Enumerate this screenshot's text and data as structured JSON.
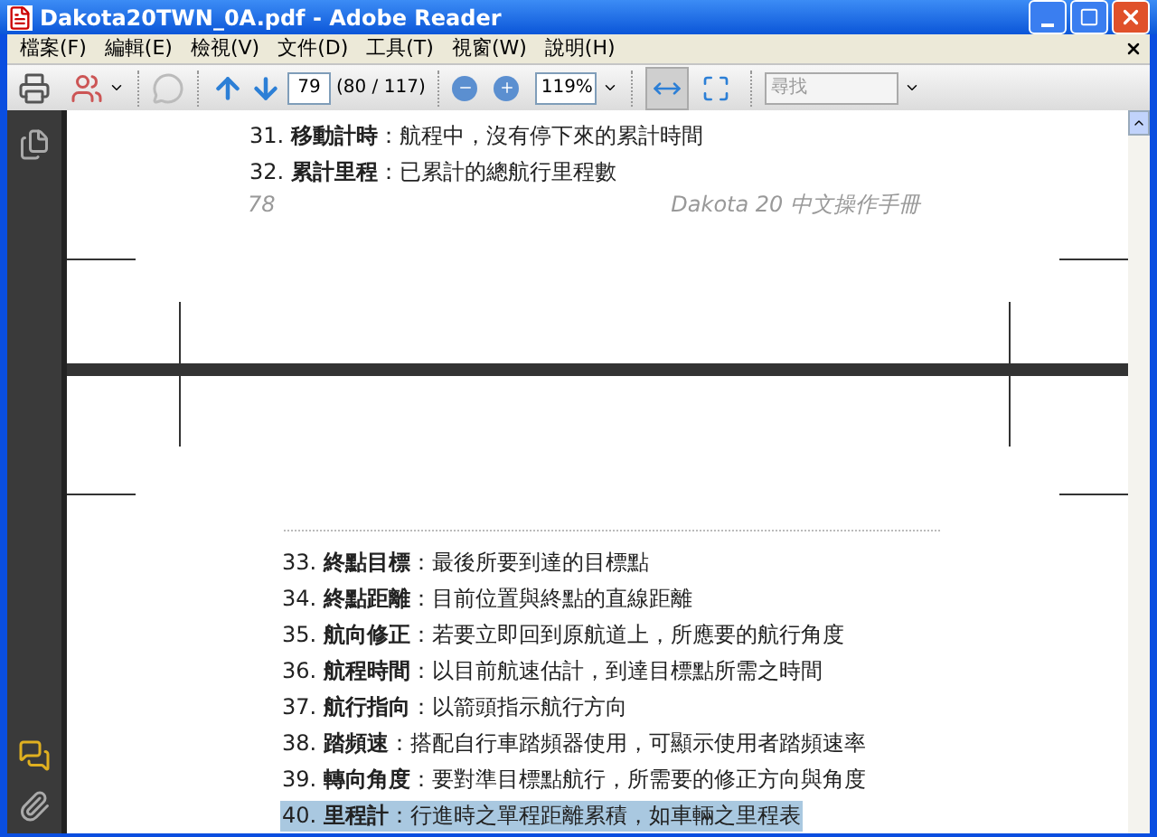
{
  "window": {
    "title": "Dakota20TWN_0A.pdf - Adobe Reader"
  },
  "menu": [
    "檔案(F)",
    "編輯(E)",
    "檢視(V)",
    "文件(D)",
    "工具(T)",
    "視窗(W)",
    "說明(H)"
  ],
  "toolbar": {
    "page_number": "79",
    "page_count": "(80 / 117)",
    "zoom": "119%",
    "search": {
      "placeholder": "尋找"
    },
    "fit_width_pressed": true
  },
  "page_top": {
    "items": [
      {
        "text": "31. **移動計時**：航程中，沒有停下來的累計時間",
        "selected": false
      },
      {
        "text": "32. **累計里程**：已累計的總航行里程數",
        "selected": false
      }
    ],
    "page_number": "78",
    "footer_title": "Dakota 20 中文操作手冊"
  },
  "page_bottom": {
    "items": [
      {
        "text": "33. **終點目標**：最後所要到達的目標點",
        "selected": false
      },
      {
        "text": "34. **終點距離**：目前位置與終點的直線距離",
        "selected": false
      },
      {
        "text": "35. **航向修正**：若要立即回到原航道上，所應要的航行角度",
        "selected": false
      },
      {
        "text": "36. **航程時間**：以目前航速估計，到達目標點所需之時間",
        "selected": false
      },
      {
        "text": "37. **航行指向**：以箭頭指示航行方向",
        "selected": false
      },
      {
        "text": "38. **踏頻速**：搭配自行車踏頻器使用，可顯示使用者踏頻速率",
        "selected": false
      },
      {
        "text": "39. **轉向角度**：要對準目標點航行，所需要的修正方向與角度",
        "selected": false
      },
      {
        "text": "40. **里程計**：行進時之單程距離累積，如車輛之里程表",
        "selected": true
      }
    ]
  }
}
